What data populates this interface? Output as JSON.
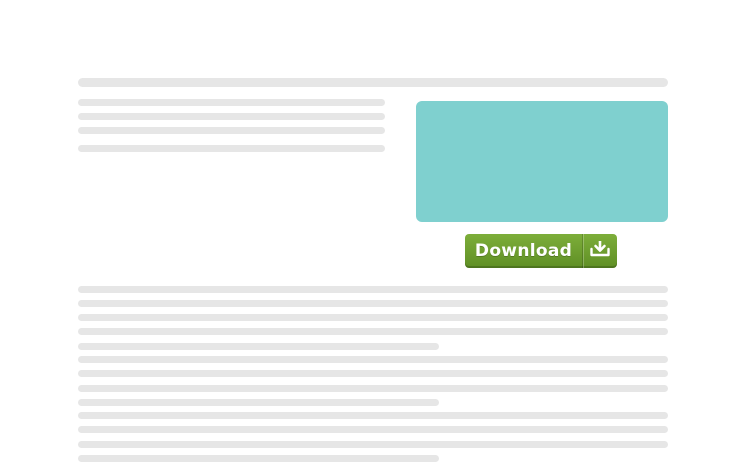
{
  "colors": {
    "placeholder_line": "#e6e6e6",
    "media_box": "#7fd0cf",
    "button_top": "#7dae3a",
    "button_bottom": "#5f8f25",
    "button_text": "#ffffff"
  },
  "download_button": {
    "label": "Download",
    "icon": "download-tray-icon"
  }
}
